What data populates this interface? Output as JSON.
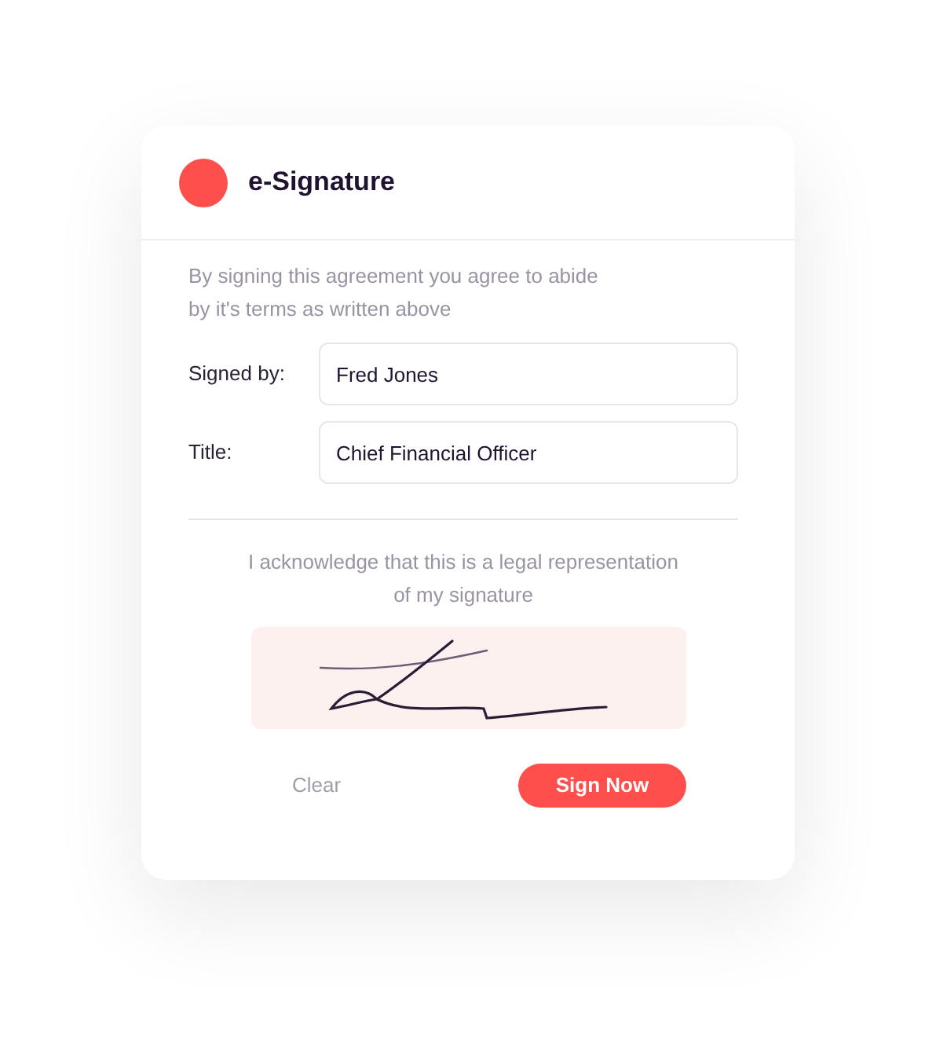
{
  "card": {
    "title": "e-Signature",
    "intro": "By signing this agreement you agree to abide\nby it's terms as written above",
    "fields": [
      {
        "label": "Signed by:",
        "value": "Fred Jones"
      },
      {
        "label": "Title:",
        "value": "Chief Financial Officer"
      }
    ],
    "acknowledgement": "I acknowledge that this is a legal representation\nof my signature",
    "buttons": [
      {
        "kind": "text",
        "label": "Clear"
      },
      {
        "kind": "primary",
        "label": "Sign Now"
      }
    ]
  }
}
